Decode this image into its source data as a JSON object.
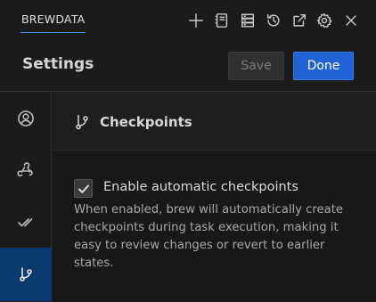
{
  "topbar": {
    "tab_label": "BREWDATA",
    "icons": [
      "plus-icon",
      "notebook-icon",
      "server-icon",
      "history-icon",
      "external-link-icon",
      "gear-icon",
      "close-icon"
    ]
  },
  "header": {
    "title": "Settings",
    "save_label": "Save",
    "done_label": "Done",
    "accent": "#1f63d4"
  },
  "sidebar": {
    "items": [
      {
        "icon": "account-icon",
        "active": false
      },
      {
        "icon": "webhook-icon",
        "active": false
      },
      {
        "icon": "double-check-icon",
        "active": false
      },
      {
        "icon": "git-branch-icon",
        "active": true
      }
    ]
  },
  "main": {
    "section_title": "Checkpoints",
    "checkbox_label": "Enable automatic checkpoints",
    "checkbox_checked": true,
    "description": "When enabled, brew will automatically create checkpoints during task execution, making it easy to review changes or revert to earlier states."
  }
}
